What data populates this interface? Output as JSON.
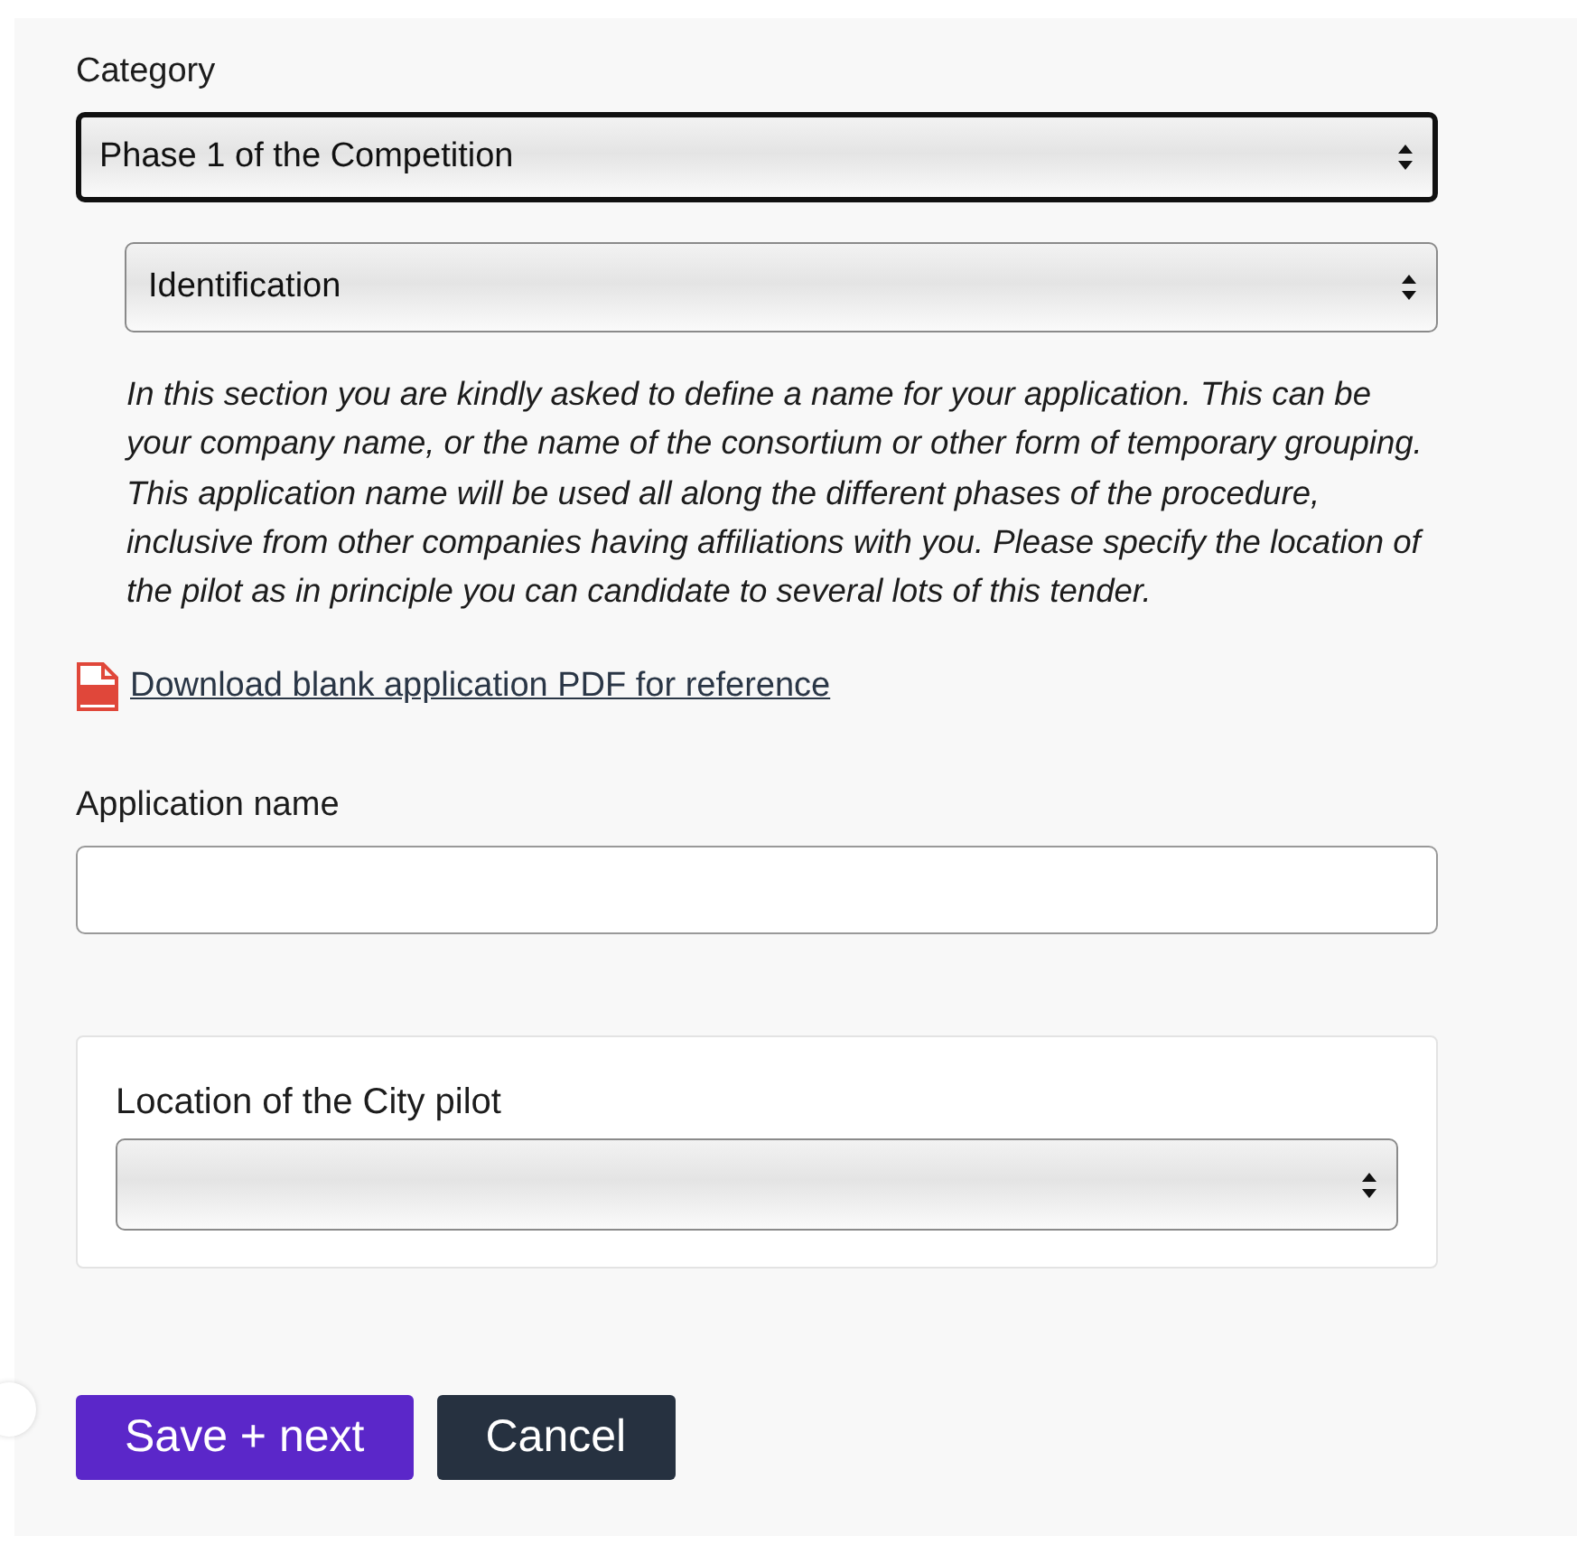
{
  "category": {
    "label": "Category",
    "value": "Phase 1 of the Competition",
    "focused": true
  },
  "section": {
    "value": "Identification",
    "focused": false
  },
  "description": "In this section you are kindly asked to define a name for your application. This can be your company name, or the name of the consortium or other form of temporary grouping. This application name will be used all along the different phases of the procedure, inclusive from other companies having affiliations with you. Please specify the location of the pilot as in principle you can candidate to several lots of this tender.",
  "download_link": "Download blank application PDF for reference",
  "application_name": {
    "label": "Application name"
  },
  "location_card": {
    "label": "Location of the City pilot"
  },
  "buttons": [
    {
      "label": "Save + next",
      "kind": "primary"
    },
    {
      "label": "Cancel",
      "kind": "secondary"
    }
  ]
}
